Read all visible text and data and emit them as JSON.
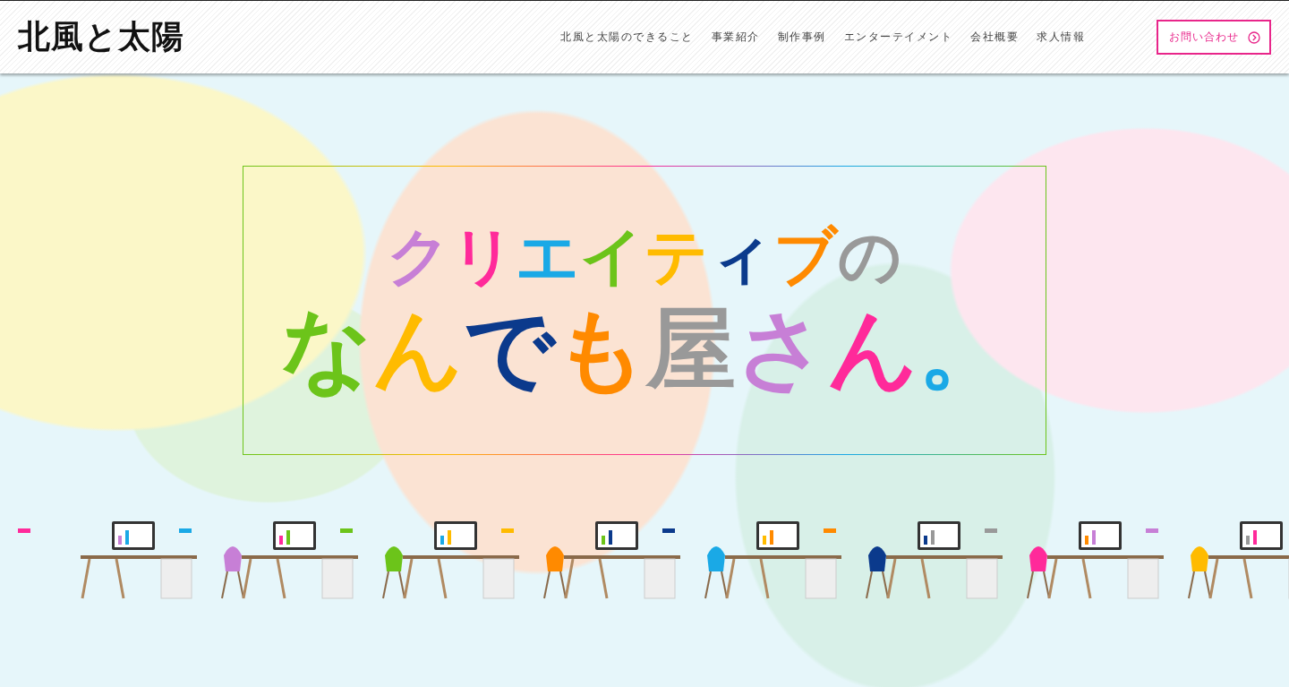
{
  "header": {
    "logo": "北風と太陽",
    "nav": [
      {
        "label": "北風と太陽のできること"
      },
      {
        "label": "事業紹介"
      },
      {
        "label": "制作事例"
      },
      {
        "label": "エンターテイメント"
      },
      {
        "label": "会社概要"
      },
      {
        "label": "求人情報"
      }
    ],
    "contact_button": "お問い合わせ"
  },
  "hero": {
    "title_lines": [
      "クリエイティブの",
      "なんでも屋さん。"
    ]
  }
}
